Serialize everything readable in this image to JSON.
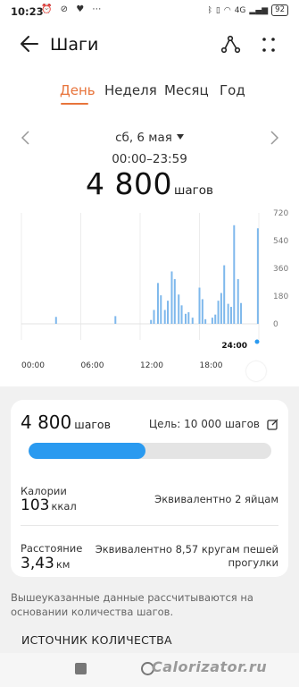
{
  "status_bar": {
    "time": "10:23",
    "signal_label": "4G",
    "battery": "92"
  },
  "header": {
    "title": "Шаги"
  },
  "tabs": [
    {
      "label": "День",
      "active": true
    },
    {
      "label": "Неделя",
      "active": false
    },
    {
      "label": "Месяц",
      "active": false
    },
    {
      "label": "Год",
      "active": false
    }
  ],
  "date_selector": {
    "date": "сб, 6 мая"
  },
  "summary": {
    "time_range": "00:00–23:59",
    "steps": "4 800",
    "steps_unit": "шагов"
  },
  "chart_data": {
    "type": "bar",
    "x_tick_labels": [
      "00:00",
      "06:00",
      "12:00",
      "18:00"
    ],
    "y_tick_labels": [
      "720",
      "540",
      "360",
      "180",
      "0"
    ],
    "ylim": [
      0,
      720
    ],
    "end_label": "24:00",
    "bar_color": "#7eb8ec",
    "series_hours_index_start": 0,
    "values": [
      0,
      0,
      0,
      0,
      0,
      0,
      0,
      0,
      0,
      0,
      0,
      0,
      0,
      0,
      0,
      0,
      0,
      0,
      0,
      0,
      0,
      0,
      0,
      0,
      0,
      0,
      0,
      0,
      0,
      0,
      0,
      0,
      0,
      0,
      0,
      0,
      0,
      0,
      0,
      0,
      0,
      0,
      0,
      0,
      0,
      0,
      0,
      0,
      0,
      0,
      0,
      0,
      0,
      0,
      0,
      0,
      0,
      0,
      0,
      0,
      0,
      0,
      0,
      0,
      0,
      0,
      0,
      0,
      0,
      0,
      0,
      0,
      0,
      0,
      0,
      0,
      0,
      0,
      0,
      0,
      0,
      0,
      0,
      0,
      0,
      0,
      0,
      0,
      0,
      0,
      0,
      0,
      0,
      0,
      0,
      0
    ]
  },
  "chart_bars": [
    {
      "x": 3.5,
      "y": 45
    },
    {
      "x": 9.5,
      "y": 50
    },
    {
      "x": 13.1,
      "y": 25
    },
    {
      "x": 13.4,
      "y": 90
    },
    {
      "x": 13.8,
      "y": 265
    },
    {
      "x": 14.1,
      "y": 185
    },
    {
      "x": 14.5,
      "y": 90
    },
    {
      "x": 14.8,
      "y": 150
    },
    {
      "x": 15.2,
      "y": 340
    },
    {
      "x": 15.5,
      "y": 290
    },
    {
      "x": 15.9,
      "y": 190
    },
    {
      "x": 16.2,
      "y": 120
    },
    {
      "x": 16.6,
      "y": 65
    },
    {
      "x": 16.9,
      "y": 75
    },
    {
      "x": 17.3,
      "y": 40
    },
    {
      "x": 18.0,
      "y": 235
    },
    {
      "x": 18.3,
      "y": 160
    },
    {
      "x": 18.6,
      "y": 30
    },
    {
      "x": 19.3,
      "y": 40
    },
    {
      "x": 19.6,
      "y": 60
    },
    {
      "x": 19.9,
      "y": 150
    },
    {
      "x": 20.2,
      "y": 200
    },
    {
      "x": 20.5,
      "y": 380
    },
    {
      "x": 20.9,
      "y": 130
    },
    {
      "x": 21.2,
      "y": 110
    },
    {
      "x": 21.5,
      "y": 640
    },
    {
      "x": 21.9,
      "y": 290
    },
    {
      "x": 22.2,
      "y": 135
    },
    {
      "x": 23.9,
      "y": 620
    }
  ],
  "goal": {
    "label": "Цель: 10 000 шагов"
  },
  "progress": {
    "fraction": 0.48,
    "color": "#2a9af0"
  },
  "calories": {
    "label": "Калории",
    "value": "103",
    "unit": "ккал",
    "equivalent": "Эквивалентно 2 яйцам"
  },
  "distance": {
    "label": "Расстояние",
    "value": "3,43",
    "unit": "км",
    "equivalent_line1": "Эквивалентно 8,57 кругам пешей",
    "equivalent_line2": "прогулки"
  },
  "note": "Вышеуказанные данные рассчитываются на основании количества шагов.",
  "section_title": "ИСТОЧНИК КОЛИЧЕСТВА",
  "watermark": "Calorizator.ru",
  "colors": {
    "accent": "#e8743b",
    "bar": "#7eb8ec",
    "progress": "#2a9af0",
    "background": "#f1f1f1"
  }
}
